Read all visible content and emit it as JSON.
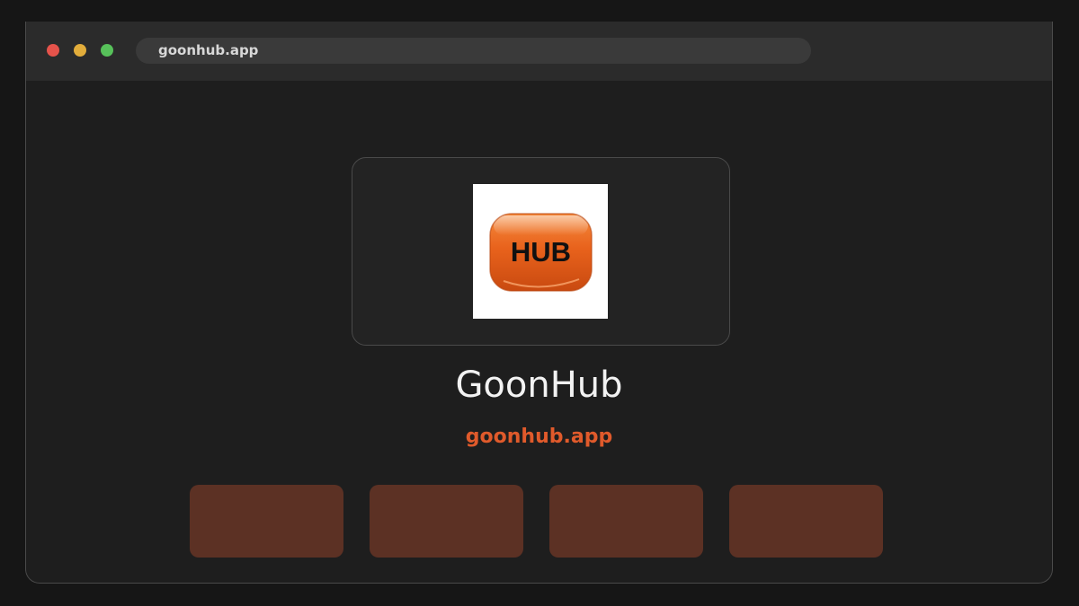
{
  "browser": {
    "url": "goonhub.app",
    "traffic_lights": {
      "close_color": "#e5534b",
      "minimize_color": "#e2ad3b",
      "maximize_color": "#57c15a"
    }
  },
  "app": {
    "logo_text": "HUB",
    "name": "GoonHub",
    "domain": "goonhub.app"
  },
  "colors": {
    "accent": "#e05a2b",
    "tile": "#5c3124",
    "logo_orange": "#e8621c",
    "background": "#1e1e1e"
  },
  "tiles": [
    {
      "id": 1
    },
    {
      "id": 2
    },
    {
      "id": 3
    },
    {
      "id": 4
    }
  ]
}
